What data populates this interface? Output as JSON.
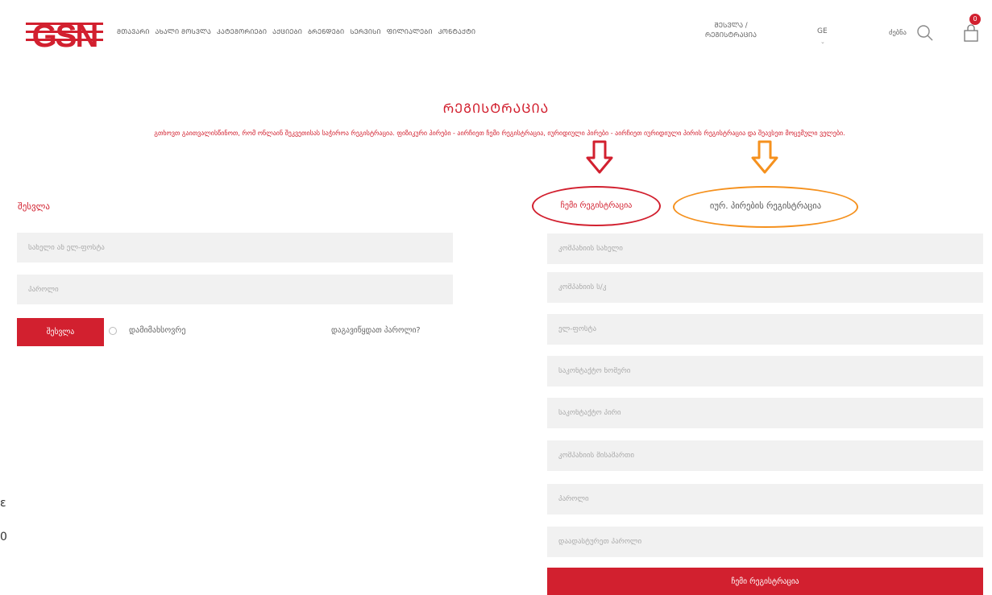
{
  "header": {
    "logo_text": "GSN",
    "nav": [
      "ᲛᲗᲐᲕᲐᲠᲘ",
      "ᲐᲮᲐᲚᲘ ᲛᲝᲡᲕᲚᲐ",
      "ᲙᲐᲢᲔᲒᲝᲠᲘᲔᲑᲘ",
      "ᲐᲥᲪᲘᲔᲑᲘ",
      "ᲑᲠᲔᲜᲓᲔᲑᲘ",
      "ᲡᲔᲠᲕᲘᲡᲘ",
      "ᲤᲘᲚᲘᲐᲚᲔᲑᲘ",
      "ᲙᲝᲜᲢᲐᲥᲢᲘ"
    ],
    "login_register": "ᲨᲔᲡᲕᲚᲐ / ᲠᲔᲒᲘᲡᲢᲠᲐᲪᲘᲐ",
    "language": "GE",
    "language_caret": "⌄",
    "search_label": "ძებნა",
    "cart_count": "0"
  },
  "page": {
    "title": "ᲠᲔᲒᲘᲡᲢᲠᲐᲪᲘᲐ",
    "note": "გთხოვთ გაითვალისწინოთ, რომ ონლაინ შეკვეთისას საჭიროა რეგისტრაცია. ფიზიკური პირები - აირჩიეთ ჩემი რეგისტრაცია, იურიდიული პირები - აირჩიეთ იურიდიული პირის რეგისტრაცია და შეავსეთ მოცემული ველები."
  },
  "login": {
    "heading": "შესვლა",
    "email_placeholder": "სახელი ან ელ-ფოსტა",
    "password_placeholder": "პაროლი",
    "button": "შესვლა",
    "remember": "დამიმახსოვრე",
    "forgot": "დაგავიწყდათ პაროლი?"
  },
  "tabs": {
    "physical": "ჩემი რეგისტრაცია",
    "legal": "იურ. პირების რეგისტრაცია"
  },
  "register": {
    "fields": [
      "კომპანიის სახელი",
      "კომპანიის ს/კ",
      "ელ-ფოსტა",
      "საკონტაქტო ნომერი",
      "საკონტაქტო პირი",
      "კომპანიის მისამართი",
      "პაროლი",
      "დაადასტურეთ პაროლი"
    ],
    "submit": "ჩემი რეგისტრაცია"
  },
  "side_text": [
    "ε",
    "0"
  ],
  "colors": {
    "brand_red": "#d2202f",
    "highlight_orange": "#f5911e",
    "field_bg": "#f1f1f1"
  }
}
